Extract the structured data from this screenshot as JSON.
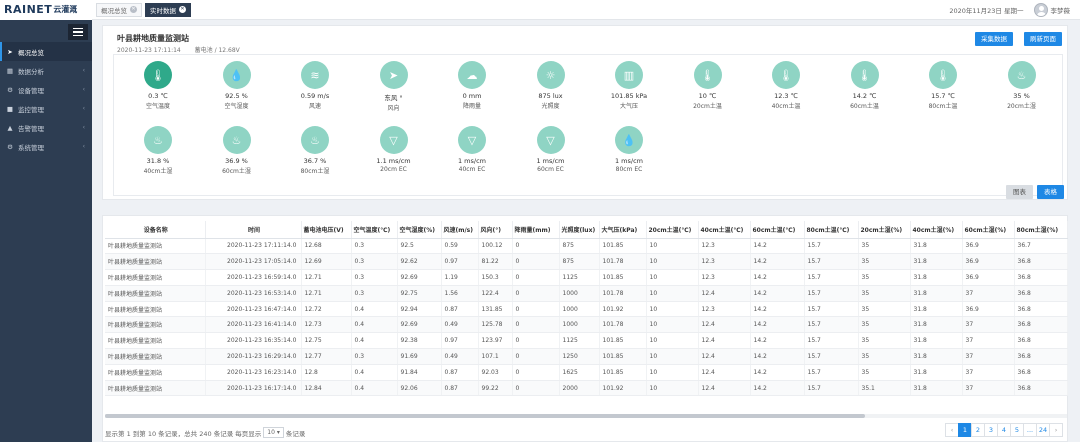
{
  "app": {
    "brand": "RAINET",
    "brand_cn": "云灌溉"
  },
  "tabs": [
    {
      "label": "概况总览",
      "active": false
    },
    {
      "label": "实时数据",
      "active": true
    }
  ],
  "header": {
    "date": "2020年11月23日 星期一",
    "user": "李梦薇"
  },
  "sidebar": {
    "items": [
      {
        "label": "概况总览",
        "icon": "send-icon",
        "active": true
      },
      {
        "label": "数据分析",
        "icon": "chart-icon"
      },
      {
        "label": "设备管理",
        "icon": "gear-icon"
      },
      {
        "label": "监控管理",
        "icon": "camera-icon"
      },
      {
        "label": "告警管理",
        "icon": "warning-icon"
      },
      {
        "label": "系统管理",
        "icon": "cogs-icon"
      }
    ]
  },
  "station": {
    "title": "叶县耕地质量监测站",
    "time": "2020-11-23 17:11:14",
    "battery": "蓄电池 / 12.68V",
    "btn_collect": "采集数据",
    "btn_refresh": "刷新页面"
  },
  "sensors": [
    {
      "value": "0.3 ℃",
      "name": "空气温度",
      "icon": "thermometer-icon",
      "glyph": "🌡",
      "dark": true
    },
    {
      "value": "92.5 %",
      "name": "空气湿度",
      "icon": "droplet-icon",
      "glyph": "💧"
    },
    {
      "value": "0.59 m/s",
      "name": "风速",
      "icon": "wind-icon",
      "glyph": "≋"
    },
    {
      "value": "东风 °",
      "name": "风向",
      "icon": "navigation-icon",
      "glyph": "➤"
    },
    {
      "value": "0 mm",
      "name": "降雨量",
      "icon": "cloud-icon",
      "glyph": "☁"
    },
    {
      "value": "875 lux",
      "name": "光照度",
      "icon": "sun-icon",
      "glyph": "☼"
    },
    {
      "value": "101.85 kPa",
      "name": "大气压",
      "icon": "bar-gauge-icon",
      "glyph": "▥"
    },
    {
      "value": "10 ℃",
      "name": "20cm土温",
      "icon": "soil-temp-icon",
      "glyph": "🌡"
    },
    {
      "value": "12.3 ℃",
      "name": "40cm土温",
      "icon": "soil-temp-icon",
      "glyph": "🌡"
    },
    {
      "value": "14.2 ℃",
      "name": "60cm土温",
      "icon": "soil-temp-icon",
      "glyph": "🌡"
    },
    {
      "value": "15.7 ℃",
      "name": "80cm土温",
      "icon": "soil-temp-icon",
      "glyph": "🌡"
    },
    {
      "value": "35 %",
      "name": "20cm土湿",
      "icon": "soil-moisture-icon",
      "glyph": "♨"
    },
    {
      "value": "31.8 %",
      "name": "40cm土湿",
      "icon": "soil-moisture-icon",
      "glyph": "♨"
    },
    {
      "value": "36.9 %",
      "name": "60cm土湿",
      "icon": "soil-moisture-icon",
      "glyph": "♨"
    },
    {
      "value": "36.7 %",
      "name": "80cm土湿",
      "icon": "soil-moisture-icon",
      "glyph": "♨"
    },
    {
      "value": "1.1 ms/cm",
      "name": "20cm EC",
      "icon": "ec-icon",
      "glyph": "▽"
    },
    {
      "value": "1 ms/cm",
      "name": "40cm EC",
      "icon": "ec-icon",
      "glyph": "▽"
    },
    {
      "value": "1 ms/cm",
      "name": "60cm EC",
      "icon": "ec-icon",
      "glyph": "▽"
    },
    {
      "value": "1 ms/cm",
      "name": "80cm EC",
      "icon": "ec-icon",
      "glyph": "💧"
    }
  ],
  "view_buttons": {
    "chart": "图表",
    "table": "表格"
  },
  "table": {
    "columns": [
      "设备名称",
      "时间",
      "蓄电池电压(V)",
      "空气温度(℃)",
      "空气湿度(%)",
      "风速(m/s)",
      "风向(°)",
      "降雨量(mm)",
      "光照度(lux)",
      "大气压(kPa)",
      "20cm土温(℃)",
      "40cm土温(℃)",
      "60cm土温(℃)",
      "80cm土温(℃)",
      "20cm土湿(%)",
      "40cm土湿(%)",
      "60cm土湿(%)",
      "80cm土湿(%)"
    ],
    "rows": [
      [
        "叶县耕地质量监测站",
        "2020-11-23 17:11:14.0",
        "12.68",
        "0.3",
        "92.5",
        "0.59",
        "100.12",
        "0",
        "875",
        "101.85",
        "10",
        "12.3",
        "14.2",
        "15.7",
        "35",
        "31.8",
        "36.9",
        "36.7"
      ],
      [
        "叶县耕地质量监测站",
        "2020-11-23 17:05:14.0",
        "12.69",
        "0.3",
        "92.62",
        "0.97",
        "81.22",
        "0",
        "875",
        "101.78",
        "10",
        "12.3",
        "14.2",
        "15.7",
        "35",
        "31.8",
        "36.9",
        "36.8"
      ],
      [
        "叶县耕地质量监测站",
        "2020-11-23 16:59:14.0",
        "12.71",
        "0.3",
        "92.69",
        "1.19",
        "150.3",
        "0",
        "1125",
        "101.85",
        "10",
        "12.3",
        "14.2",
        "15.7",
        "35",
        "31.8",
        "36.9",
        "36.8"
      ],
      [
        "叶县耕地质量监测站",
        "2020-11-23 16:53:14.0",
        "12.71",
        "0.3",
        "92.75",
        "1.56",
        "122.4",
        "0",
        "1000",
        "101.78",
        "10",
        "12.4",
        "14.2",
        "15.7",
        "35",
        "31.8",
        "37",
        "36.8"
      ],
      [
        "叶县耕地质量监测站",
        "2020-11-23 16:47:14.0",
        "12.72",
        "0.4",
        "92.94",
        "0.87",
        "131.85",
        "0",
        "1000",
        "101.92",
        "10",
        "12.3",
        "14.2",
        "15.7",
        "35",
        "31.8",
        "36.9",
        "36.8"
      ],
      [
        "叶县耕地质量监测站",
        "2020-11-23 16:41:14.0",
        "12.73",
        "0.4",
        "92.69",
        "0.49",
        "125.78",
        "0",
        "1000",
        "101.78",
        "10",
        "12.4",
        "14.2",
        "15.7",
        "35",
        "31.8",
        "37",
        "36.8"
      ],
      [
        "叶县耕地质量监测站",
        "2020-11-23 16:35:14.0",
        "12.75",
        "0.4",
        "92.38",
        "0.97",
        "123.97",
        "0",
        "1125",
        "101.85",
        "10",
        "12.4",
        "14.2",
        "15.7",
        "35",
        "31.8",
        "37",
        "36.8"
      ],
      [
        "叶县耕地质量监测站",
        "2020-11-23 16:29:14.0",
        "12.77",
        "0.3",
        "91.69",
        "0.49",
        "107.1",
        "0",
        "1250",
        "101.85",
        "10",
        "12.4",
        "14.2",
        "15.7",
        "35",
        "31.8",
        "37",
        "36.8"
      ],
      [
        "叶县耕地质量监测站",
        "2020-11-23 16:23:14.0",
        "12.8",
        "0.4",
        "91.84",
        "0.87",
        "92.03",
        "0",
        "1625",
        "101.85",
        "10",
        "12.4",
        "14.2",
        "15.7",
        "35",
        "31.8",
        "37",
        "36.8"
      ],
      [
        "叶县耕地质量监测站",
        "2020-11-23 16:17:14.0",
        "12.84",
        "0.4",
        "92.06",
        "0.87",
        "99.22",
        "0",
        "2000",
        "101.92",
        "10",
        "12.4",
        "14.2",
        "15.7",
        "35.1",
        "31.8",
        "37",
        "36.8"
      ]
    ]
  },
  "footer": {
    "info_prefix": "显示第 1 到第 10 条记录，总共 240 条记录 每页显示",
    "page_size": "10",
    "info_suffix": "条记录",
    "pages": [
      "‹",
      "1",
      "2",
      "3",
      "4",
      "5",
      "...",
      "24",
      "›"
    ],
    "active_page": "1"
  }
}
